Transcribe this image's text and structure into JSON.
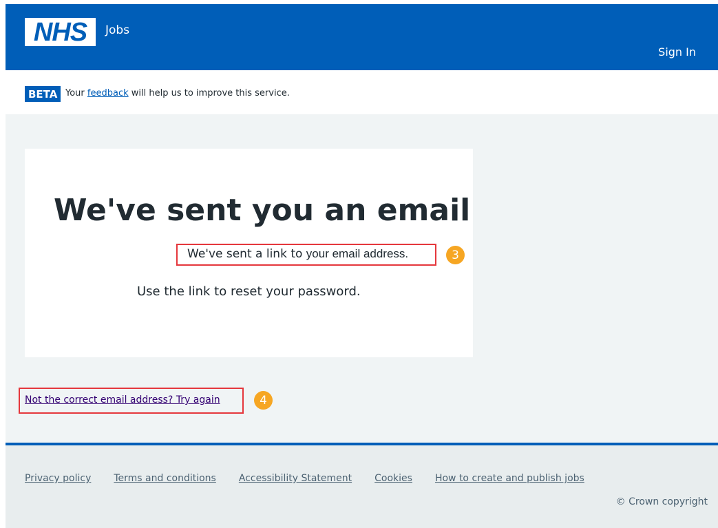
{
  "header": {
    "logo_text": "NHS",
    "service_name": "Jobs",
    "sign_in": "Sign In"
  },
  "beta_banner": {
    "tag": "BETA",
    "text_before": "Your",
    "link": "feedback",
    "text_after": "will help us to improve this service."
  },
  "main": {
    "title": "We've sent you an email",
    "sent_text_prefix": "We've sent a link to",
    "sent_text_email": "your email address.",
    "reset_text": "Use the link to reset your password.",
    "retry_link": "Not the correct email address? Try again"
  },
  "annotations": {
    "badge_3": "3",
    "badge_4": "4"
  },
  "footer": {
    "links": [
      "Privacy policy",
      "Terms and conditions",
      "Accessibility Statement",
      "Cookies",
      "How to create and publish jobs"
    ],
    "copyright": "© Crown copyright"
  },
  "colors": {
    "nhs_blue": "#005eb8",
    "annotation_red": "#e5373c",
    "badge_orange": "#f6a623",
    "background": "#f0f4f5"
  }
}
